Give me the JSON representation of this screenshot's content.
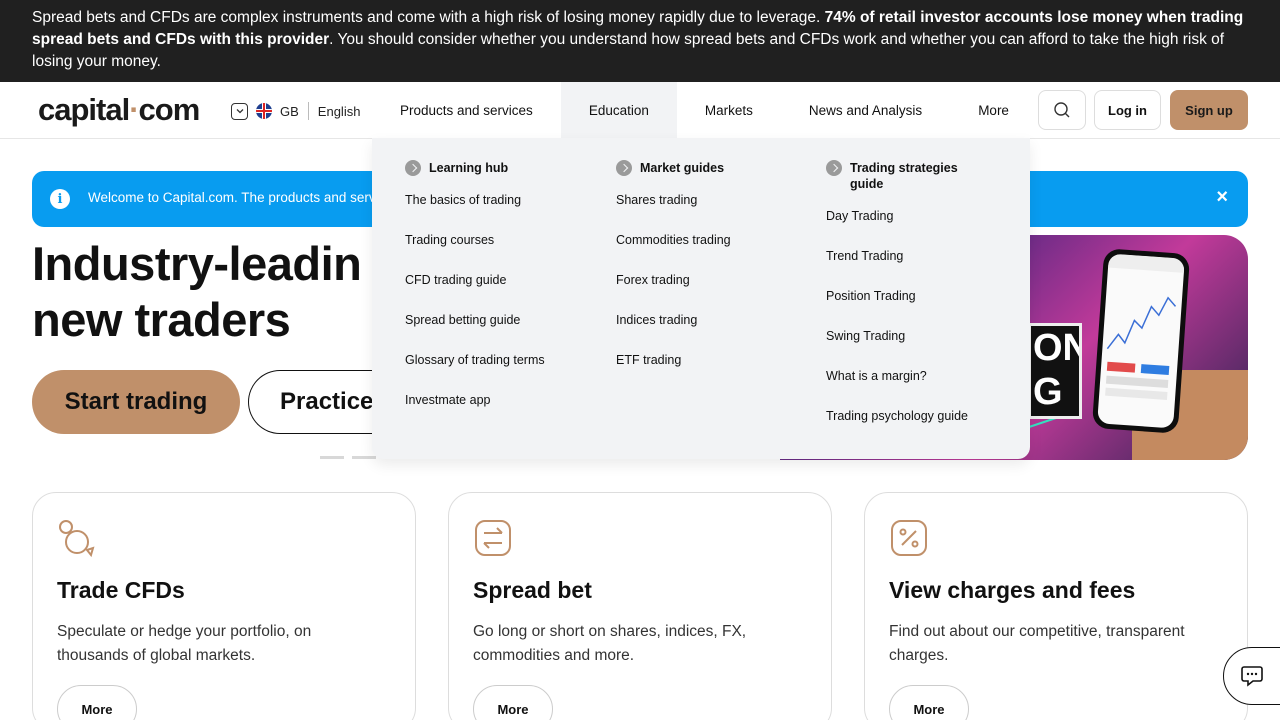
{
  "risk_banner": {
    "text_1": "Spread bets and CFDs are complex instruments and come with a high risk of losing money rapidly due to leverage. ",
    "bold": "74% of retail investor accounts lose money when trading spread bets and CFDs with this provider",
    "text_2": ". You should consider whether you understand how spread bets and CFDs work and whether you can afford to take the high risk of losing your money."
  },
  "header": {
    "logo_left": "capital",
    "logo_dot": "·",
    "logo_right": "com",
    "region": "GB",
    "language": "English",
    "nav": [
      {
        "label": "Products and services"
      },
      {
        "label": "Education"
      },
      {
        "label": "Markets"
      },
      {
        "label": "News and Analysis"
      },
      {
        "label": "More"
      }
    ],
    "login_label": "Log in",
    "signup_label": "Sign up"
  },
  "mega_menu": {
    "columns": [
      {
        "heading": "Learning hub",
        "links": [
          "The basics of trading",
          "Trading courses",
          "CFD trading guide",
          "Spread betting guide",
          "Glossary of trading terms",
          "Investmate app"
        ]
      },
      {
        "heading": "Market guides",
        "links": [
          "Shares trading",
          "Commodities trading",
          "Forex trading",
          "Indices trading",
          "ETF trading"
        ]
      },
      {
        "heading_line1": "Trading strategies",
        "heading_line2": "guide",
        "links": [
          "Day Trading",
          "Trend Trading",
          "Position Trading",
          "Swing Trading",
          "What is a margin?",
          "Trading psychology guide"
        ]
      }
    ]
  },
  "info_banner": {
    "text": "Welcome to Capital.com. The products and serv",
    "close": "×"
  },
  "hero": {
    "title_line1": "Industry-leadin",
    "title_line2": "new traders",
    "primary_btn": "Start trading",
    "secondary_btn": "Practice",
    "sign_text_1": "ON",
    "sign_text_2": "G",
    "carousel_active_index": 2
  },
  "cards": [
    {
      "title": "Trade CFDs",
      "text": "Speculate or hedge your portfolio, on thousands of global markets.",
      "more": "More",
      "icon": "coins-icon"
    },
    {
      "title": "Spread bet",
      "text": "Go long or short on shares, indices, FX, commodities and more.",
      "more": "More",
      "icon": "swap-arrows-icon"
    },
    {
      "title": "View charges and fees",
      "text": "Find out about our competitive, transparent charges.",
      "more": "More",
      "icon": "percent-icon"
    }
  ],
  "colors": {
    "accent": "#c0906a",
    "info": "#089cf0",
    "banner_bg": "#202020"
  }
}
